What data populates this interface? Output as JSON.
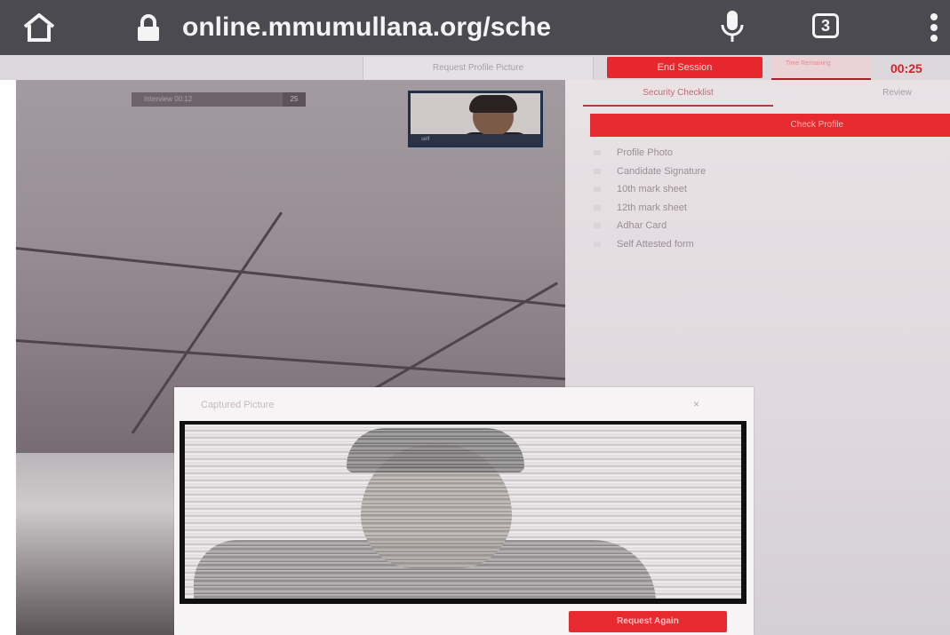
{
  "browser": {
    "url": "online.mmumullana.org/sche",
    "tab_count": "3"
  },
  "toolbar": {
    "request_profile_picture": "Request Profile Picture",
    "end_session": "End Session",
    "timer_label": "Time Remaining",
    "timer_value": "00:25"
  },
  "video": {
    "label": "Interview  00:12",
    "count": "25",
    "self_preview_label": "self"
  },
  "panel": {
    "tabs": [
      "Security Checklist",
      "Review"
    ],
    "check_profile": "Check Profile",
    "checklist": [
      "Profile Photo",
      "Candidate Signature",
      "10th mark sheet",
      "12th mark sheet",
      "Adhar Card",
      "Self Attested form"
    ]
  },
  "modal": {
    "title": "Captured Picture",
    "close": "×",
    "request_again": "Request Again"
  },
  "colors": {
    "accent_red": "#e62a2e",
    "browser_bar": "#4a4a50"
  }
}
